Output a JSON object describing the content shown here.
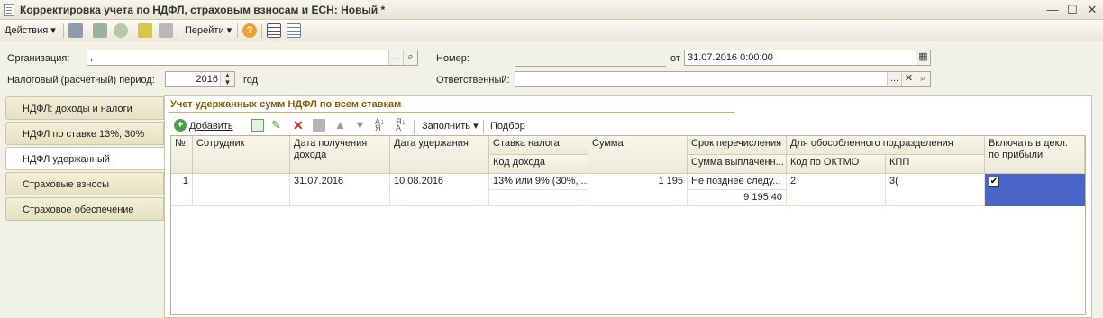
{
  "window": {
    "title": "Корректировка учета по НДФЛ, страховым взносам и ЕСН: Новый *"
  },
  "toolbar": {
    "actions_label": "Действия",
    "goto_label": "Перейти"
  },
  "header": {
    "org_label": "Организация:",
    "org_value": ",",
    "number_label": "Номер:",
    "number_value": "",
    "from_label": "от",
    "date_value": "31.07.2016  0:00:00",
    "period_label": "Налоговый (расчетный) период:",
    "period_value": "2016",
    "year_label": "год",
    "responsible_label": "Ответственный:",
    "responsible_value": ""
  },
  "sidebar": {
    "items": [
      {
        "label": "НДФЛ: доходы и налоги"
      },
      {
        "label": "НДФЛ по ставке 13%, 30%"
      },
      {
        "label": "НДФЛ удержанный"
      },
      {
        "label": "Страховые взносы"
      },
      {
        "label": "Страховое обеспечение"
      }
    ]
  },
  "panel": {
    "title": "Учет удержанных сумм НДФЛ по всем ставкам",
    "add_label": "Добавить",
    "fill_label": "Заполнить",
    "select_label": "Подбор"
  },
  "table": {
    "headers": {
      "num": "№",
      "employee": "Сотрудник",
      "income_date": "Дата получения дохода",
      "withhold_date": "Дата удержания",
      "tax_rate": "Ставка налога",
      "income_code": "Код дохода",
      "amount": "Сумма",
      "transfer_term": "Срок перечисления",
      "paid_sum": "Сумма выплаченн...",
      "separate_unit": "Для обособленного подразделения",
      "oktmo": "Код по ОКТМО",
      "kpp": "КПП",
      "include_profit": "Включать в декл. по прибыли"
    },
    "rows": [
      {
        "num": "1",
        "employee": "",
        "income_date": "31.07.2016",
        "withhold_date": "10.08.2016",
        "tax_rate": "13% или 9% (30%, ...",
        "income_code": "",
        "amount": "1 195",
        "transfer_term": "Не позднее следу...",
        "paid_sum": "9 195,40",
        "oktmo": "2",
        "kpp": "3(",
        "include_profit": true
      }
    ]
  },
  "colors": {
    "selected_cell": "#4a64c8",
    "panel_title": "#8a5a00",
    "nav_bg": "#ece7ca"
  },
  "icons": [
    "document-icon",
    "minimize-icon",
    "maximize-icon",
    "close-icon",
    "help-icon",
    "add-icon",
    "delete-icon",
    "edit-icon",
    "move-up-icon",
    "move-down-icon",
    "sort-asc-icon",
    "sort-desc-icon",
    "search-icon",
    "calendar-icon",
    "checkbox-icon"
  ]
}
